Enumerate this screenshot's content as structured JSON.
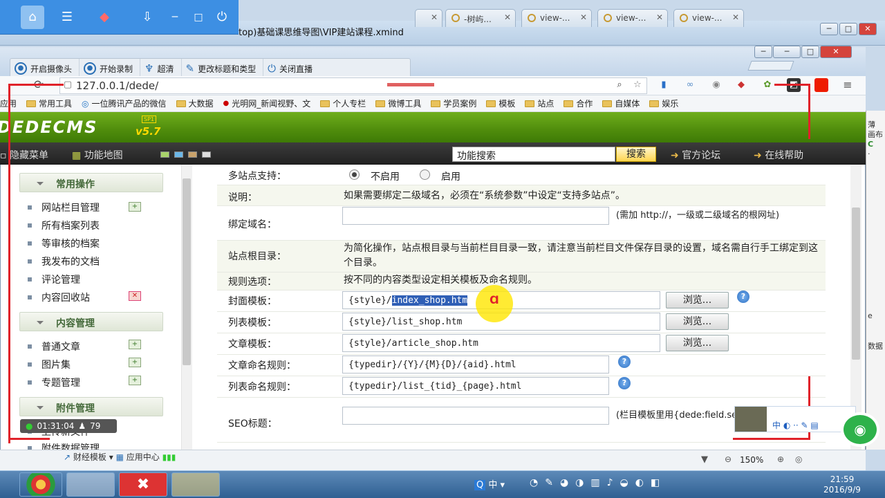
{
  "background_window": {
    "title": "top)基础课思维导图\\VIP建站课程.xmind",
    "right_panel_text": [
      "薄",
      "画布",
      "C",
      "·",
      "e",
      "数据"
    ]
  },
  "recorder_toolbar": {
    "buttons": [
      {
        "label": "开启摄像头",
        "icon": "camera-icon"
      },
      {
        "label": "开始录制",
        "icon": "record-icon"
      },
      {
        "label": "超清",
        "icon": "quality-icon"
      },
      {
        "label": "更改标题和类型",
        "icon": "pencil-icon"
      },
      {
        "label": "关闭直播",
        "icon": "power-icon"
      }
    ],
    "timer": "01:31:04",
    "viewers": "79"
  },
  "browser": {
    "tabs": [
      "-树屿...",
      "view-...",
      "view-...",
      "view-..."
    ],
    "url": "127.0.0.1/dede/",
    "bookmarks": [
      "应用",
      "常用工具",
      "一位腾讯产品的微信",
      "大数据",
      "光明网_新闻视野、文",
      "个人专栏",
      "微博工具",
      "学员案例",
      "模板",
      "站点",
      "合作",
      "自媒体",
      "娱乐"
    ],
    "zoom": "150%"
  },
  "dede": {
    "logo": "DEDECMS",
    "version": "v5.7",
    "edition": "SP1",
    "menu": {
      "hide_menu": "隐藏菜单",
      "function_map": "功能地图",
      "search_value": "功能搜索",
      "search_button": "搜索",
      "forum": "官方论坛",
      "help": "在线帮助"
    },
    "sidebar": {
      "sections": [
        {
          "title": "常用操作",
          "items": [
            "网站栏目管理",
            "所有档案列表",
            "等审核的档案",
            "我发布的文档",
            "评论管理",
            "内容回收站"
          ]
        },
        {
          "title": "内容管理",
          "items": [
            "普通文章",
            "图片集",
            "专题管理"
          ]
        },
        {
          "title": "附件管理",
          "items": [
            "上传新文件",
            "附件数据管理"
          ]
        }
      ]
    },
    "form": {
      "multisite_label": "多站点支持：",
      "multisite_off": "不启用",
      "multisite_on": "启用",
      "desc_label": "说明：",
      "desc_text": "如果需要绑定二级域名，必须在“系统参数”中设定“支持多站点”。",
      "bind_label": "绑定域名：",
      "bind_hint": "(需加 http://，一级或二级域名的根网址)",
      "root_label": "站点根目录：",
      "root_text": "为简化操作，站点根目录与当前栏目目录一致，请注意当前栏目文件保存目录的设置，域名需自行手工绑定到这个目录。",
      "rule_label": "规则选项：",
      "rule_text": "按不同的内容类型设定相关模板及命名规则。",
      "cover_label": "封面模板：",
      "cover_prefix": "{style}/",
      "cover_selected": "index_shop.htm",
      "list_label": "列表模板：",
      "list_value": "{style}/list_shop.htm",
      "article_label": "文章模板：",
      "article_value": "{style}/article_shop.htm",
      "browse": "浏览...",
      "article_rule_label": "文章命名规则：",
      "article_rule_value": "{typedir}/{Y}/{M}{D}/{aid}.html",
      "list_rule_label": "列表命名规则：",
      "list_rule_value": "{typedir}/list_{tid}_{page}.html",
      "seo_label": "SEO标题：",
      "seo_hint": "(栏目模板里用{dede:field.seotitle/}调用)"
    }
  },
  "status": {
    "left_item": "财经模板",
    "app_center": "应用中心"
  },
  "taskbar": {
    "time": "21:59",
    "date": "2016/9/9",
    "ime": "中"
  },
  "colors": {
    "dede_green": "#4f8c0c",
    "accent_red": "#e0222a",
    "highlight": "#2f5fb6"
  }
}
